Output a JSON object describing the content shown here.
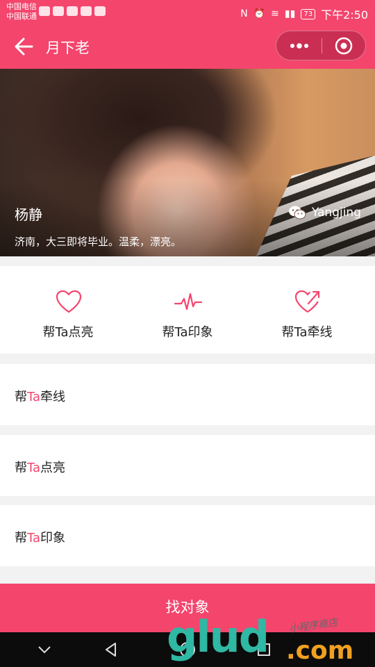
{
  "status_bar": {
    "carrier_1": "中国电信",
    "carrier_2": "中国联通",
    "battery": "73",
    "time": "下午2:50"
  },
  "nav": {
    "title": "月下老"
  },
  "profile": {
    "name": "杨静",
    "wechat_id": "Yangjing",
    "description": "济南，大三即将毕业。温柔，漂亮。"
  },
  "actions": [
    {
      "label": "帮Ta点亮",
      "icon": "heart-icon"
    },
    {
      "label": "帮Ta印象",
      "icon": "heartbeat-icon"
    },
    {
      "label": "帮Ta牵线",
      "icon": "heart-arrow-icon"
    }
  ],
  "menu": [
    {
      "prefix": "帮",
      "highlight": "Ta",
      "suffix": "牵线"
    },
    {
      "prefix": "帮",
      "highlight": "Ta",
      "suffix": "点亮"
    },
    {
      "prefix": "帮",
      "highlight": "Ta",
      "suffix": "印象"
    }
  ],
  "cta": {
    "label": "找对象"
  },
  "watermark": {
    "brand": "glud",
    "domain": ".com",
    "sub": "小程序商店"
  },
  "colors": {
    "accent": "#f4456d",
    "system_nav": "#0c0c0c"
  }
}
